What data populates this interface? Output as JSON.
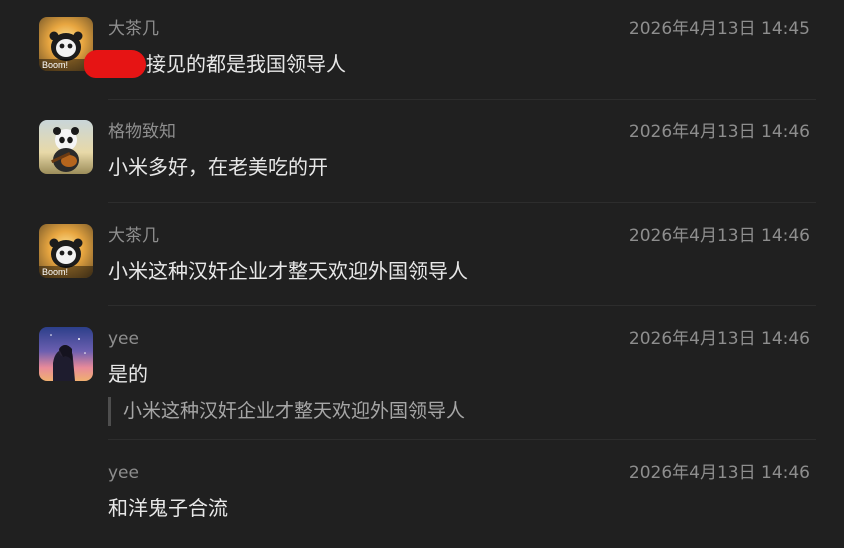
{
  "messages": [
    {
      "author": "大茶几",
      "time": "2026年4月13日 14:45",
      "text": "接见的都是我国领导人",
      "avatar": "boom-panda-avatar",
      "avatar_badge": "Boom!"
    },
    {
      "author": "格物致知",
      "time": "2026年4月13日 14:46",
      "text": "小米多好，在老美吃的开",
      "avatar": "guitar-panda-avatar"
    },
    {
      "author": "大茶几",
      "time": "2026年4月13日 14:46",
      "text": "小米这种汉奸企业才整天欢迎外国领导人",
      "avatar": "boom-panda-avatar",
      "avatar_badge": "Boom!"
    },
    {
      "author": "yee",
      "time": "2026年4月13日 14:46",
      "text": "是的",
      "quote": "小米这种汉奸企业才整天欢迎外国领导人",
      "avatar": "sunset-girl-avatar"
    },
    {
      "author": "yee",
      "time": "2026年4月13日 14:46",
      "text": "和洋鬼子合流"
    }
  ],
  "colors": {
    "background": "#202020",
    "meta_text": "#8e8e8e",
    "body_text": "#e8e8e8",
    "quote_text": "#a6a6a6",
    "redaction": "#e61414"
  }
}
